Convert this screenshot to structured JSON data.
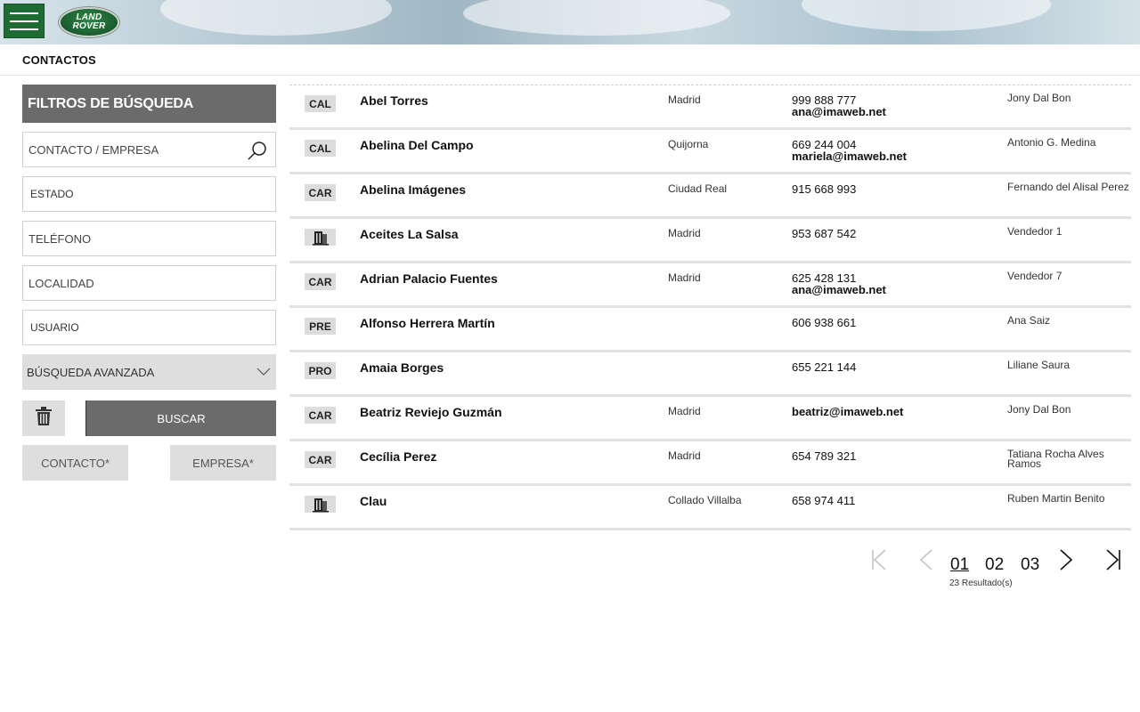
{
  "header": {
    "logo_line1": "LAND",
    "logo_line2": "ROVER",
    "brand_color": "#1e6b34"
  },
  "page_title": "CONTACTOS",
  "filters": {
    "heading": "FILTROS DE BÚSQUEDA",
    "contact_placeholder": "CONTACTO / EMPRESA",
    "estado": "ESTADO",
    "telefono": "TELÉFONO",
    "localidad": "LOCALIDAD",
    "usuario": "USUARIO",
    "advanced": "BÚSQUEDA AVANZADA",
    "search_button": "BUSCAR",
    "contact_toggle": "CONTACTO*",
    "company_toggle": "EMPRESA*"
  },
  "contacts": [
    {
      "badge": "CAL",
      "icon": "",
      "name": "Abel Torres",
      "city": "Madrid",
      "phone": "999 888 777",
      "email": "ana@imaweb.net",
      "user": "Jony Dal Bon"
    },
    {
      "badge": "CAL",
      "icon": "",
      "name": "Abelina Del Campo",
      "city": "Quijorna",
      "phone": "669 244 004",
      "email": "mariela@imaweb.net",
      "user": "Antonio G. Medina"
    },
    {
      "badge": "CAR",
      "icon": "",
      "name": "Abelina Imágenes",
      "city": "Ciudad Real",
      "phone": "915 668 993",
      "email": "",
      "user": "Fernando del Alisal Perez"
    },
    {
      "badge": "",
      "icon": "building-icon",
      "name": "Aceites La Salsa",
      "city": "Madrid",
      "phone": "953 687 542",
      "email": "",
      "user": "Vendedor 1"
    },
    {
      "badge": "CAR",
      "icon": "",
      "name": "Adrian Palacio Fuentes",
      "city": "Madrid",
      "phone": "625 428 131",
      "email": "ana@imaweb.net",
      "user": "Vendedor 7"
    },
    {
      "badge": "PRE",
      "icon": "",
      "name": "Alfonso Herrera Martín",
      "city": "",
      "phone": "606 938 661",
      "email": "",
      "user": "Ana Saiz"
    },
    {
      "badge": "PRO",
      "icon": "",
      "name": "Amaia Borges",
      "city": "",
      "phone": "655 221 144",
      "email": "",
      "user": "Liliane Saura"
    },
    {
      "badge": "CAR",
      "icon": "",
      "name": "Beatriz Reviejo Guzmán",
      "city": "Madrid",
      "phone": "",
      "email": "beatriz@imaweb.net",
      "user": "Jony Dal Bon"
    },
    {
      "badge": "CAR",
      "icon": "",
      "name": "Cecília Perez",
      "city": "Madrid",
      "phone": "654 789 321",
      "email": "",
      "user": "Tatiana Rocha Alves Ramos"
    },
    {
      "badge": "",
      "icon": "building-icon",
      "name": "Clau",
      "city": "Collado Villalba",
      "phone": "658 974 411",
      "email": "",
      "user": "Ruben Martin Benito"
    }
  ],
  "pagination": {
    "pages": [
      "01",
      "02",
      "03"
    ],
    "current": "01",
    "results": "23 Resultado(s)"
  }
}
